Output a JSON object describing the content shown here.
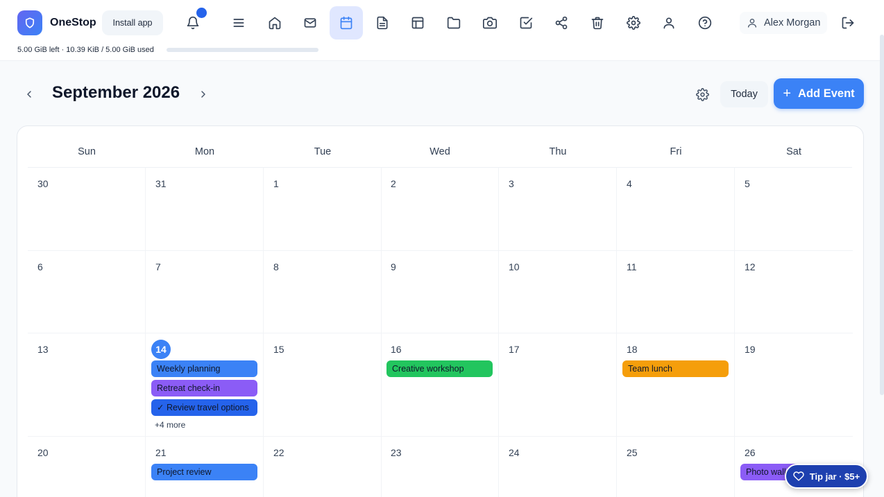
{
  "app": {
    "name": "OneStop",
    "install_label": "Install app"
  },
  "nav": [
    {
      "icon": "menu-icon",
      "active": false
    },
    {
      "icon": "home-icon",
      "active": false
    },
    {
      "icon": "mail-icon",
      "active": false
    },
    {
      "icon": "calendar-icon",
      "active": true
    },
    {
      "icon": "document-icon",
      "active": false
    },
    {
      "icon": "table-icon",
      "active": false
    },
    {
      "icon": "folder-icon",
      "active": false
    },
    {
      "icon": "camera-icon",
      "active": false
    },
    {
      "icon": "checkbox-icon",
      "active": false
    },
    {
      "icon": "share-icon",
      "active": false
    },
    {
      "icon": "trash-icon",
      "active": false
    },
    {
      "icon": "gear-icon",
      "active": false
    },
    {
      "icon": "user-icon",
      "active": false
    },
    {
      "icon": "help-icon",
      "active": false
    }
  ],
  "user": {
    "name": "Alex Morgan"
  },
  "storage": {
    "text": "5.00 GiB left · 10.39 KiB / 5.00 GiB used",
    "used_fraction": 2e-06
  },
  "calendar": {
    "month_title": "September 2026",
    "today_label": "Today",
    "add_event_label": "Add Event",
    "weekdays": [
      "Sun",
      "Mon",
      "Tue",
      "Wed",
      "Thu",
      "Fri",
      "Sat"
    ],
    "weeks": [
      [
        {
          "day": "30",
          "events": []
        },
        {
          "day": "31",
          "events": []
        },
        {
          "day": "1",
          "events": []
        },
        {
          "day": "2",
          "events": []
        },
        {
          "day": "3",
          "events": []
        },
        {
          "day": "4",
          "events": []
        },
        {
          "day": "5",
          "events": []
        }
      ],
      [
        {
          "day": "6",
          "events": []
        },
        {
          "day": "7",
          "events": []
        },
        {
          "day": "8",
          "events": []
        },
        {
          "day": "9",
          "events": []
        },
        {
          "day": "10",
          "events": []
        },
        {
          "day": "11",
          "events": []
        },
        {
          "day": "12",
          "events": []
        }
      ],
      [
        {
          "day": "13",
          "events": []
        },
        {
          "day": "14",
          "today": true,
          "events": [
            {
              "label": "Weekly planning",
              "color": "#3b82f6"
            },
            {
              "label": "Retreat check-in",
              "color": "#8b5cf6"
            },
            {
              "label": "✓ Review travel options",
              "color": "#2563eb"
            }
          ],
          "more": "+4 more"
        },
        {
          "day": "15",
          "events": []
        },
        {
          "day": "16",
          "events": [
            {
              "label": "Creative workshop",
              "color": "#22c55e"
            }
          ]
        },
        {
          "day": "17",
          "events": []
        },
        {
          "day": "18",
          "events": [
            {
              "label": "Team lunch",
              "color": "#f59e0b"
            }
          ]
        },
        {
          "day": "19",
          "events": []
        }
      ],
      [
        {
          "day": "20",
          "events": []
        },
        {
          "day": "21",
          "events": [
            {
              "label": "Project review",
              "color": "#3b82f6"
            }
          ]
        },
        {
          "day": "22",
          "events": []
        },
        {
          "day": "23",
          "events": []
        },
        {
          "day": "24",
          "events": []
        },
        {
          "day": "25",
          "events": []
        },
        {
          "day": "26",
          "events": [
            {
              "label": "Photo walk",
              "color": "#8b5cf6"
            }
          ]
        }
      ]
    ]
  },
  "tipjar": {
    "label": "Tip jar · $5+"
  }
}
